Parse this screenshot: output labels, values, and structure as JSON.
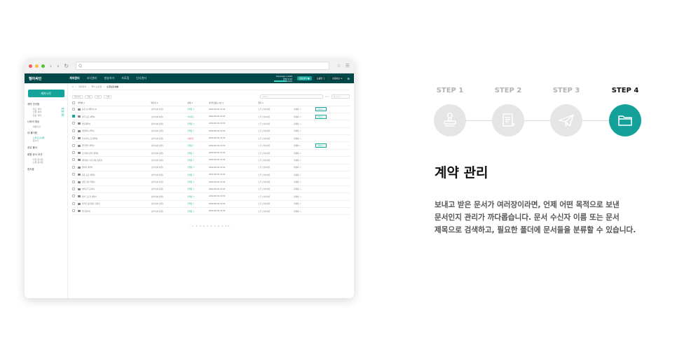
{
  "browser": {
    "address": "Q",
    "star": "☆",
    "menu": "☰"
  },
  "app": {
    "brand": "텔아싸인",
    "nav": [
      "계약관리",
      "서식관리",
      "발송하기",
      "자료함",
      "인사관리"
    ],
    "credit_label": "Premium 1,000",
    "credit_sub": "잔여 0/10",
    "credit_fraction": 0.7,
    "buttons": [
      "알림센터 ●",
      "도움말 ⓘ",
      "홍길동님 ⇲"
    ],
    "gear": "⚙"
  },
  "sidebar": {
    "new_doc": "계약시작",
    "sections": [
      {
        "title": "계약 관리함",
        "items": [
          {
            "label": "· 최근 계약",
            "badge": "24"
          },
          {
            "label": "· 진행 계약",
            "badge": "12"
          },
          {
            "label": "· 완료 계약",
            "badge": "32"
          }
        ]
      },
      {
        "title": "나와의 맹승",
        "items": [
          {
            "label": "· 대용인금",
            "badge": ""
          }
        ]
      },
      {
        "title": "내 폴더함",
        "items": [
          {
            "label": "· 노무신고서류",
            "badge": ""
          },
          {
            "label": "· 증서사",
            "badge": ""
          }
        ]
      },
      {
        "title": "공유 폴더",
        "items": []
      },
      {
        "title": "회원 문서 보관",
        "items": [
          {
            "label": "· 다른 문서함",
            "badge": ""
          },
          {
            "label": "· 오류 문서함",
            "badge": ""
          }
        ]
      },
      {
        "title": "휴지통",
        "items": []
      }
    ]
  },
  "main": {
    "crumbs": [
      "⌂",
      "계약관리",
      "폴더 보관함",
      "노무신고서류"
    ],
    "tools": [
      "이동하기",
      "이름",
      "공유",
      "삭제"
    ],
    "search_placeholder": "Search ...",
    "filter_icon": "Q  ▽",
    "select": "최신 순 ▾",
    "columns": [
      "계약명 ⇕",
      "발신자 ⇕",
      "상태 ⇕",
      "마지막 활동 시간 ⇕",
      "폴더 ⇕",
      "",
      ""
    ],
    "rows": [
      {
        "name": "표준근로계약서 (1)",
        "sender": "김수미(서 사원)",
        "status": "진행중 ↑",
        "time": "2022-08-30 14:30",
        "folder": "노무 | 인사서류",
        "action": "서명하기 ▾",
        "checked": false,
        "red": false
      },
      {
        "name": "용역 공급 계약서",
        "sender": "김수미(서 사원)",
        "status": "복수완료",
        "time": "2022-08-30 14:30",
        "folder": "노무 | 인사서류",
        "action": "서명하기 ▾",
        "checked": true,
        "red": false
      },
      {
        "name": "연봉계약서",
        "sender": "김수미(서 사원)",
        "status": "진행중 ↑",
        "time": "2022-08-30 14:30",
        "folder": "노무 | 인사서류",
        "action": "",
        "checked": false,
        "red": false
      },
      {
        "name": "비밀유지 서약서",
        "sender": "김수미(서 사원)",
        "status": "진행중 ↑",
        "time": "2022-08-30 14:30",
        "folder": "노무 | 인사서류",
        "action": "",
        "checked": false,
        "red": false
      },
      {
        "name": "인수인계 근로계약서",
        "sender": "김수미(서 사원)",
        "status": "서명취소",
        "time": "2022-08-30 14:30",
        "folder": "노무 | 인사서류",
        "action": "",
        "checked": false,
        "red": true
      },
      {
        "name": "업무위탁 계약서",
        "sender": "김수미(서 사원)",
        "status": "진행중 ↑",
        "time": "2022-08-30 14:30",
        "folder": "노무 | 인사서류",
        "action": "서명하기 ▾",
        "checked": false,
        "red": false
      },
      {
        "name": "프리랜서 용역 계약서",
        "sender": "김수미(서 사원)",
        "status": "진행중 ↑",
        "time": "2022-08-30 14:30",
        "folder": "노무 | 인사서류",
        "action": "",
        "checked": false,
        "red": false
      },
      {
        "name": "개인정보 수집 이용 동의서",
        "sender": "김수미(서 사원)",
        "status": "진행중 ↑",
        "time": "2022-08-30 14:30",
        "folder": "노무 | 인사서류",
        "action": "",
        "checked": false,
        "red": false
      },
      {
        "name": "임대차 계약서",
        "sender": "김수미(서 사원)",
        "status": "진행중 ↑",
        "time": "2022-08-30 14:30",
        "folder": "노무 | 인사서류",
        "action": "",
        "checked": false,
        "red": false
      },
      {
        "name": "물품 공급 계약서",
        "sender": "김수미(서 사원)",
        "status": "진행중 ↑",
        "time": "2022-08-30 14:30",
        "folder": "노무 | 인사서류",
        "action": "",
        "checked": false,
        "red": false
      },
      {
        "name": "겸업 금지 약정서",
        "sender": "김수미(서 사원)",
        "status": "진행중 ↑",
        "time": "2022-08-30 14:30",
        "folder": "노무 | 인사서류",
        "action": "",
        "checked": false,
        "red": false
      },
      {
        "name": "재택근무 동의서",
        "sender": "김수미(서 사원)",
        "status": "진행중 ↑",
        "time": "2022-08-30 14:30",
        "folder": "노무 | 인사서류",
        "action": "",
        "checked": false,
        "red": false
      },
      {
        "name": "파견 근로자 계약서",
        "sender": "김수미(서 사원)",
        "status": "진행중 ↑",
        "time": "2022-08-30 14:30",
        "folder": "노무 | 인사서류",
        "action": "",
        "checked": false,
        "red": false
      },
      {
        "name": "퇴직금 중간정산 신청서",
        "sender": "김수미(서 사원)",
        "status": "진행중 ↑",
        "time": "2022-08-30 14:30",
        "folder": "노무 | 인사서류",
        "action": "",
        "checked": false,
        "red": false
      },
      {
        "name": "업무협약서",
        "sender": "김수미(서 사원)",
        "status": "진행중 ↑",
        "time": "2022-08-30 14:30",
        "folder": "노무 | 인사서류",
        "action": "",
        "checked": false,
        "red": false
      }
    ],
    "row_tail": "자세히 >",
    "pagination": "‹ 1 2 3 4 5 6 7 8 9 10 ›"
  },
  "steps": {
    "labels": [
      "STEP 1",
      "STEP 2",
      "STEP 3",
      "STEP 4"
    ],
    "icons": [
      "stamp-icon",
      "document-icon",
      "paper-plane-icon",
      "folder-icon"
    ],
    "active_index": 3,
    "active_color": "#14a19a"
  },
  "content": {
    "title": "계약 관리",
    "desc_lines": [
      "보내고 받은 문서가 여러장이라면, 언제 어떤 목적으로 보낸",
      "문서인지 관리가 까다롭습니다. 문서 수신자 이름 또는 문서",
      "제목으로 검색하고, 필요한 폴더에 문서들을 분류할 수 있습니다."
    ]
  }
}
